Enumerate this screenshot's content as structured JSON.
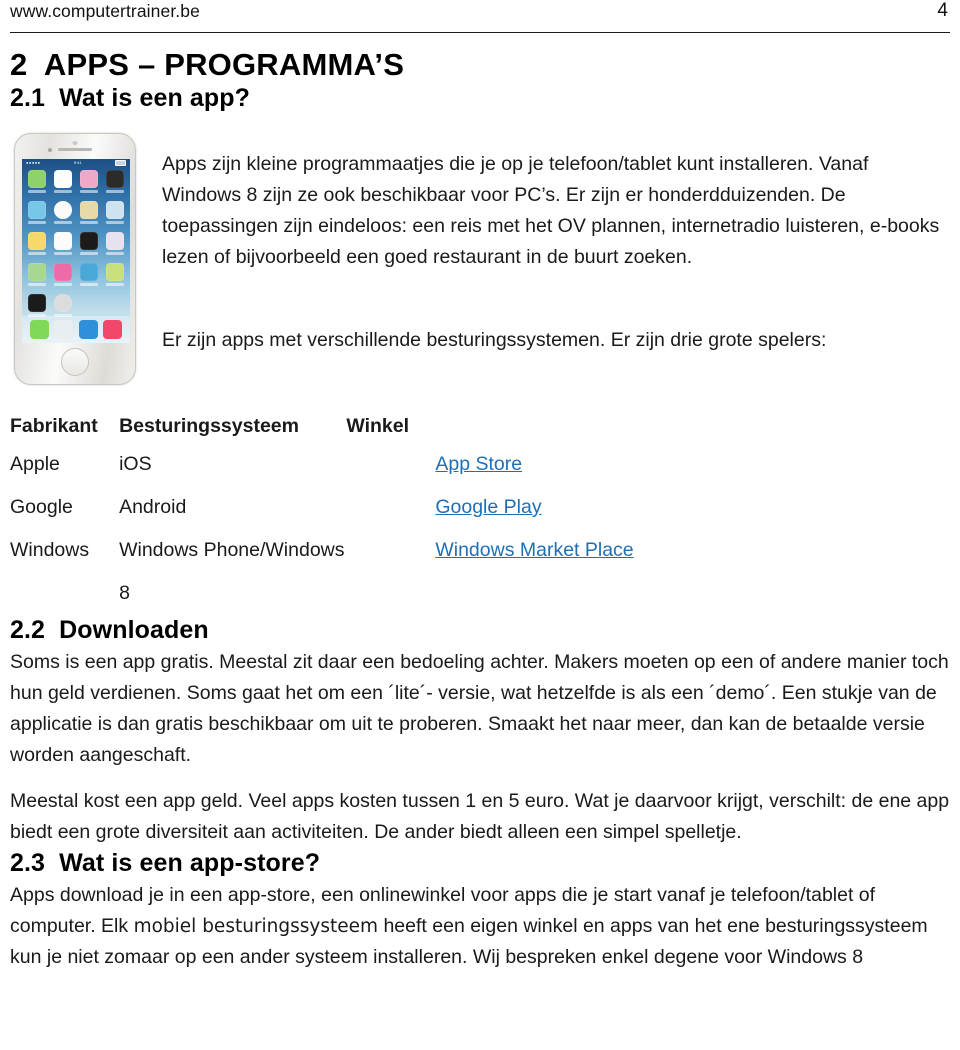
{
  "header": {
    "site": "www.computertrainer.be",
    "page_number": "4"
  },
  "chapter": {
    "title": "2  APPS – PROGRAMMA’S"
  },
  "sections": {
    "s21": {
      "heading": "2.1  Wat is een app?",
      "paragraph": "Apps zijn kleine programmaatjes die je op je telefoon/tablet kunt installeren. Vanaf Windows 8 zijn ze ook beschikbaar voor PC’s. Er zijn er honderdduizenden. De toepassingen zijn eindeloos: een reis met het OV plannen, internetradio luisteren, e-books lezen of bijvoorbeeld een goed restaurant in de buurt zoeken.",
      "lead": "Er zijn apps met verschillende besturingssystemen. Er zijn drie grote spelers:"
    },
    "s22": {
      "heading": "2.2  Downloaden",
      "paragraph1": "Soms is een app gratis. Meestal zit daar een bedoeling achter. Makers moeten op een of andere manier toch hun geld verdienen. Soms gaat het om een ´lite´- versie, wat hetzelfde is als een ´demo´. Een stukje van de applicatie is dan gratis beschikbaar om uit te proberen. Smaakt het naar meer, dan kan de betaalde versie worden aangeschaft.",
      "paragraph2": "Meestal kost een app geld. Veel apps kosten tussen 1 en 5 euro. Wat je daarvoor krijgt, verschilt: de ene app biedt een grote diversiteit aan activiteiten. De ander biedt alleen een simpel spelletje."
    },
    "s23": {
      "heading": "2.3  Wat is een app-store?",
      "paragraph_part1": "Apps download je in een app-store, een onlinewinkel voor apps die je start vanaf je telefoon/tablet of computer. Elk ",
      "paragraph_emph": "mobiel besturingssysteem",
      "paragraph_part2": " heeft een eigen winkel en apps van het ene besturingssysteem kun je niet zomaar op een ander systeem installeren. Wij bespreken enkel degene voor Windows 8"
    }
  },
  "os_table": {
    "headers": [
      "Fabrikant",
      "Besturingssysteem",
      "Winkel"
    ],
    "rows": [
      {
        "fabrikant": "Apple",
        "besturingssysteem": "iOS",
        "winkel": "App Store"
      },
      {
        "fabrikant": "Google",
        "besturingssysteem": "Android",
        "winkel": "Google Play"
      },
      {
        "fabrikant": "Windows",
        "besturingssysteem": "Windows Phone/Windows 8",
        "winkel": "Windows Market Place"
      }
    ]
  },
  "figure": {
    "alt_name": "iphone-home-screen-photo",
    "status_left": "●●●●●",
    "status_time": "9:41",
    "grid_icon_colors": [
      "#8fd16a",
      "#fdfdfd",
      "#f0a8c8",
      "#2b2b2b",
      "#79c7e8",
      "#fbfbfb",
      "#e8d9a8",
      "#cfe3ee",
      "#f7d96b",
      "#fbfbfb",
      "#1b1b1b",
      "#e8e1f0",
      "#a8d88f",
      "#ef6ba8",
      "#49a8d8",
      "#c9e07a",
      "#1b1b1b",
      "#dcdcdc"
    ],
    "dock_icon_colors": [
      "#7ed957",
      "#e8eef2",
      "#2f8fd8",
      "#f2476b"
    ]
  },
  "colors": {
    "link": "#1f6fb5",
    "text": "#1a1a1a",
    "rule": "#1a1a1a"
  }
}
